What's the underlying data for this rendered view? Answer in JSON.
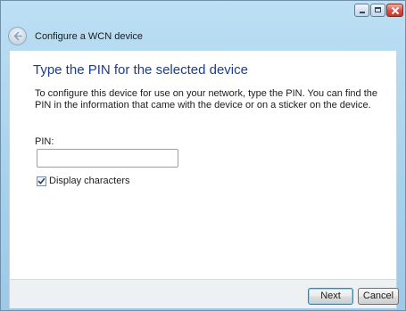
{
  "window": {
    "title": "Configure a WCN device"
  },
  "header": {
    "back_icon": "back-arrow-icon"
  },
  "main": {
    "heading": "Type the PIN for the selected device",
    "instructions": "To configure this device for use on your network, type the PIN. You can find the PIN in the information that came with the device or on a sticker on the device.",
    "pin_label": "PIN:",
    "pin_value": "",
    "display_characters_label": "Display characters",
    "display_characters_checked": true
  },
  "footer": {
    "next_label": "Next",
    "cancel_label": "Cancel"
  },
  "colors": {
    "heading": "#1e3c8c",
    "title_bar": "#a9d3ee",
    "close_button": "#d9534a"
  }
}
